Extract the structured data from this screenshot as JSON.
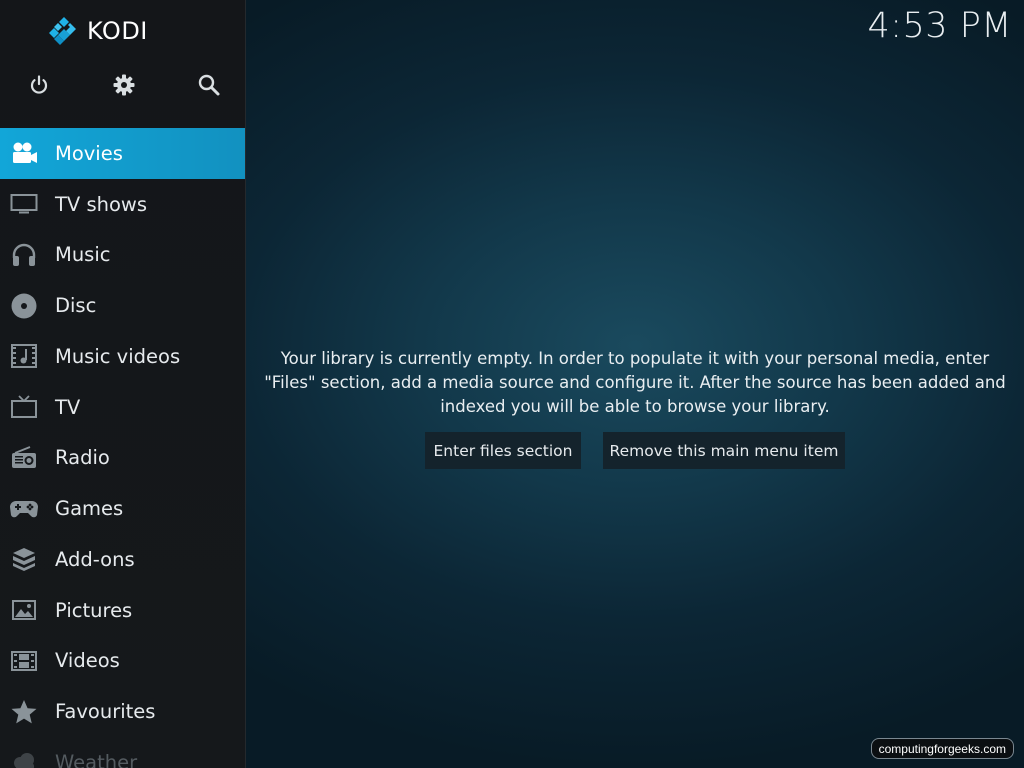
{
  "app": {
    "logo_text": "KODI",
    "time": "4:53 PM"
  },
  "top_icons": [
    {
      "name": "power-icon"
    },
    {
      "name": "gear-icon"
    },
    {
      "name": "search-icon"
    }
  ],
  "menu": {
    "items": [
      {
        "label": "Movies",
        "icon": "movie-camera-icon",
        "active": true
      },
      {
        "label": "TV shows",
        "icon": "monitor-icon"
      },
      {
        "label": "Music",
        "icon": "headphones-icon"
      },
      {
        "label": "Disc",
        "icon": "disc-icon"
      },
      {
        "label": "Music videos",
        "icon": "music-video-icon"
      },
      {
        "label": "TV",
        "icon": "tv-icon"
      },
      {
        "label": "Radio",
        "icon": "radio-icon"
      },
      {
        "label": "Games",
        "icon": "gamepad-icon"
      },
      {
        "label": "Add-ons",
        "icon": "addons-box-icon"
      },
      {
        "label": "Pictures",
        "icon": "picture-icon"
      },
      {
        "label": "Videos",
        "icon": "film-strip-icon"
      },
      {
        "label": "Favourites",
        "icon": "star-icon"
      },
      {
        "label": "Weather",
        "icon": "weather-cloud-icon",
        "faded": true
      }
    ]
  },
  "main": {
    "message": "Your library is currently empty. In order to populate it with your personal media, enter \"Files\" section, add a media source and configure it. After the source has been added and indexed you will be able to browse your library.",
    "buttons": {
      "enter_files": "Enter files section",
      "remove_item": "Remove this main menu item"
    }
  },
  "watermark": "computingforgeeks.com",
  "colors": {
    "accent": "#12a6d8",
    "sidebar_bg": "#15181b",
    "background": "#12384a",
    "button_bg": "#14232c"
  }
}
